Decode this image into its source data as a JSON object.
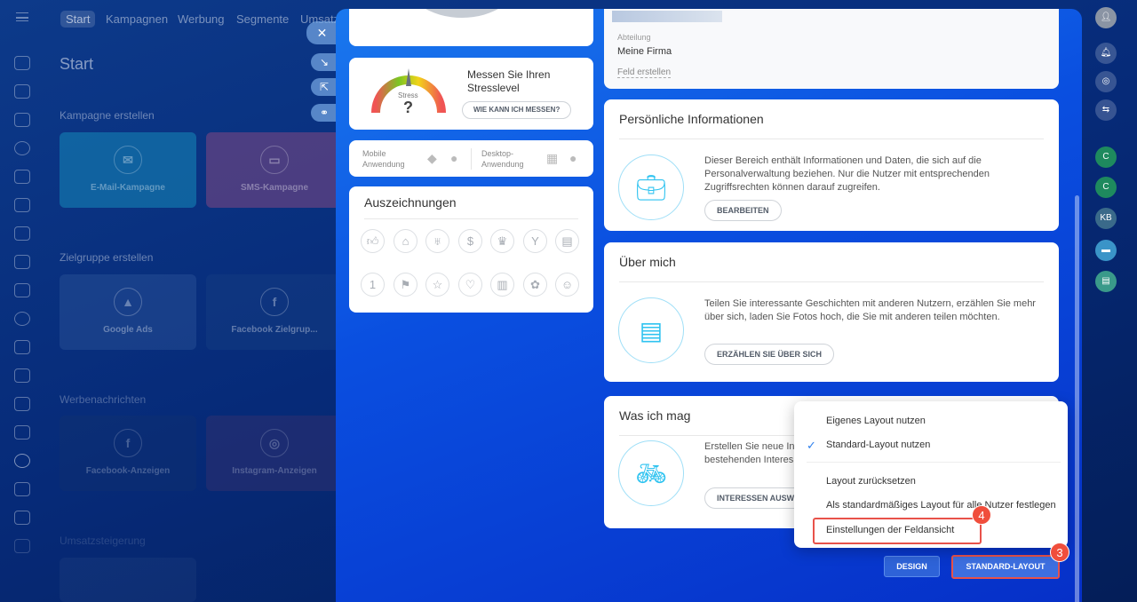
{
  "topnav": {
    "items": [
      "Start",
      "Kampagnen",
      "Werbung",
      "Segmente",
      "Umsatz"
    ]
  },
  "main": {
    "title": "Start",
    "sections": [
      {
        "title": "Kampagne erstellen",
        "tiles": [
          "E-Mail-Kampagne",
          "SMS-Kampagne"
        ]
      },
      {
        "title": "Zielgruppe erstellen",
        "tiles": [
          "Google Ads",
          "Facebook Zielgrup..."
        ]
      },
      {
        "title": "Werbenachrichten",
        "tiles": [
          "Facebook-Anzeigen",
          "Instagram-Anzeigen"
        ]
      },
      {
        "title": "Umsatzsteigerung"
      }
    ]
  },
  "stress": {
    "gauge_label": "Stress",
    "value": "?",
    "title": "Messen Sie Ihren Stresslevel",
    "button": "WIE KANN ICH MESSEN?"
  },
  "apps": {
    "mobile": "Mobile Anwendung",
    "desktop": "Desktop-Anwendung"
  },
  "awards": {
    "title": "Auszeichnungen"
  },
  "profile": {
    "dept_label": "Abteilung",
    "dept_value": "Meine Firma",
    "create_field": "Feld erstellen"
  },
  "personal": {
    "title": "Persönliche Informationen",
    "desc": "Dieser Bereich enthält Informationen und Daten, die sich auf die Personalverwaltung beziehen. Nur die Nutzer mit entsprechenden Zugriffsrechten können darauf zugreifen.",
    "button": "BEARBEITEN"
  },
  "about": {
    "title": "Über mich",
    "desc": "Teilen Sie interessante Geschichten mit anderen Nutzern, erzählen Sie mehr über sich, laden Sie Fotos hoch, die Sie mit anderen teilen möchten.",
    "button": "ERZÄHLEN SIE ÜBER SICH"
  },
  "likes": {
    "title": "Was ich mag",
    "desc": "Erstellen Sie neue Int\nbestehenden Interes",
    "button": "INTERESSEN AUSW"
  },
  "menu": {
    "items": [
      "Eigenes Layout nutzen",
      "Standard-Layout nutzen",
      "Layout zurücksetzen",
      "Als standardmäßiges Layout für alle Nutzer festlegen",
      "Einstellungen der Feldansicht"
    ],
    "checked": 1
  },
  "footer": {
    "design": "DESIGN",
    "standard": "STANDARD-LAYOUT"
  },
  "badges": {
    "step3": "3",
    "step4": "4"
  },
  "right_sidebar": {
    "c1": "C",
    "c2": "C",
    "kb": "KB"
  }
}
